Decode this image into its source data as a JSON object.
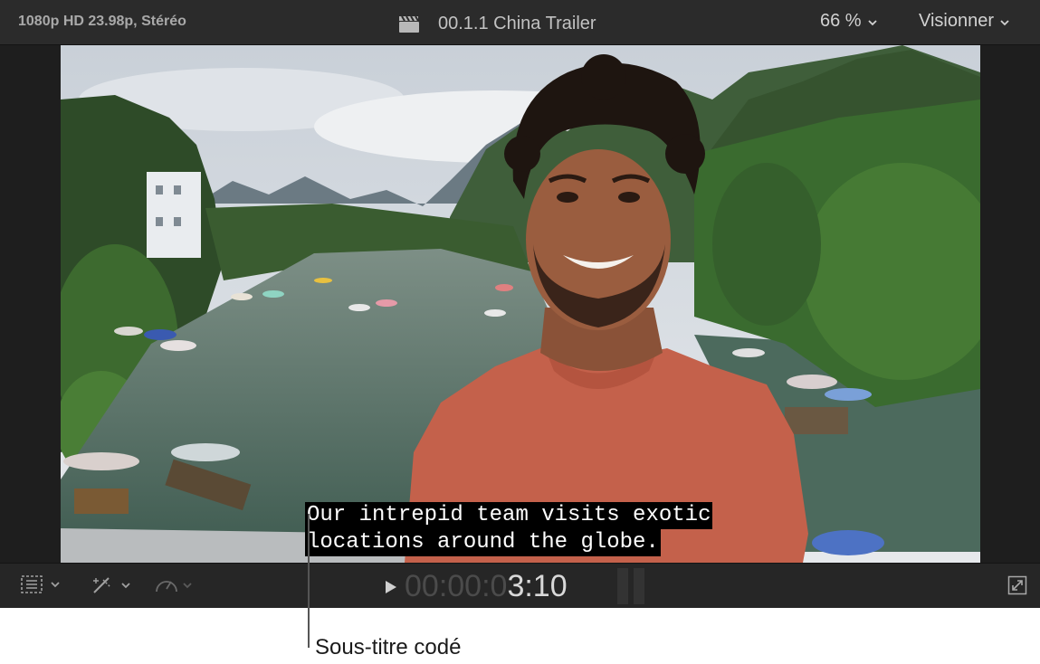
{
  "topbar": {
    "format": "1080p HD 23.98p, Stéréo",
    "clip_icon": "clapperboard-icon",
    "clip_title": "00.1.1 China Trailer",
    "zoom": "66 %",
    "view_menu": "Visionner"
  },
  "viewer": {
    "caption_line1": "Our intrepid team visits exotic",
    "caption_line2": "locations around the globe."
  },
  "bottombar": {
    "tools": [
      "layout-icon",
      "magic-wand-icon",
      "speed-gauge-icon"
    ],
    "timecode_dim": "00:00:0",
    "timecode_bright": "3:10",
    "fullscreen_icon": "fullscreen-icon"
  },
  "callout": {
    "label": "Sous-titre codé"
  },
  "colors": {
    "toolbar_bg": "#2b2b2b",
    "caption_bg": "#000000",
    "caption_text": "#ffffff"
  }
}
